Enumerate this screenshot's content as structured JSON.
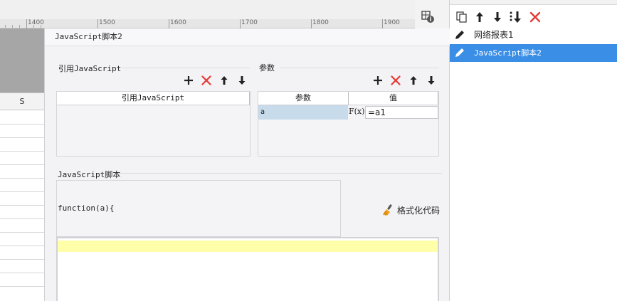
{
  "ruler": {
    "labels": [
      "1400",
      "1500",
      "1600",
      "1700",
      "1800",
      "1900"
    ]
  },
  "sheet": {
    "column_header": "S"
  },
  "dialog": {
    "title": "JavaScript脚本2",
    "ref_section": {
      "title": "引用JavaScript",
      "column_header": "引用JavaScript",
      "toolbar_icons": [
        "plus-icon",
        "delete-x-icon",
        "arrow-up-icon",
        "arrow-down-icon"
      ]
    },
    "param_section": {
      "title": "参数",
      "columns": [
        "参数",
        "值"
      ],
      "rows": [
        {
          "name": "a",
          "formula_button": "F(x)",
          "value": "=a1"
        }
      ],
      "toolbar_icons": [
        "plus-icon",
        "delete-x-icon",
        "arrow-up-icon",
        "arrow-down-icon"
      ]
    },
    "script_section": {
      "title": "JavaScript脚本",
      "preview": "function(a){",
      "format_button": "格式化代码",
      "editor_value": ""
    }
  },
  "right_panel": {
    "toolbar_icons": [
      "copy-icon",
      "arrow-up-icon",
      "arrow-down-icon",
      "move-down-icon",
      "delete-x-icon"
    ],
    "items": [
      {
        "label": "网络报表1",
        "selected": false
      },
      {
        "label": "JavaScript脚本2",
        "selected": true
      }
    ]
  },
  "colors": {
    "selection_blue": "#3a8ee6",
    "delete_red": "#e53935",
    "param_cell": "#c7dbea",
    "editor_line": "#ffffaa"
  }
}
